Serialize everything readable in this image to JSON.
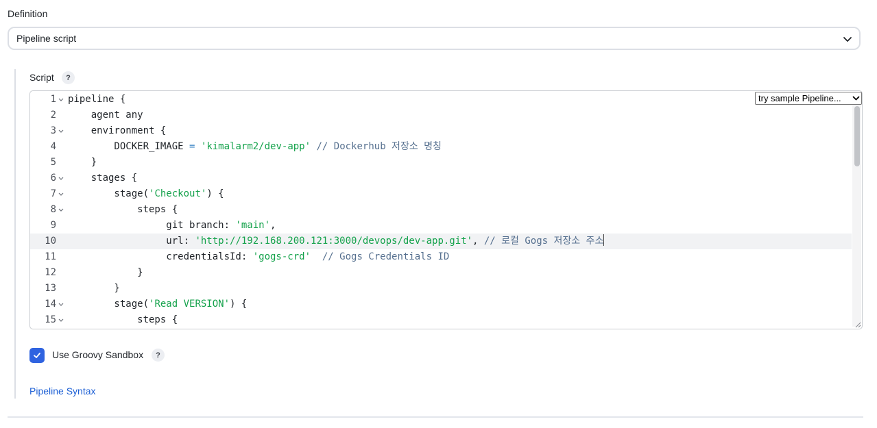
{
  "definition": {
    "label": "Definition",
    "selected": "Pipeline script"
  },
  "script": {
    "label": "Script",
    "help": "?",
    "sample_select": "try sample Pipeline...",
    "lines": [
      {
        "num": "1",
        "fold": true,
        "active": false,
        "tokens": [
          [
            "t",
            "pipeline {"
          ]
        ]
      },
      {
        "num": "2",
        "fold": false,
        "active": false,
        "tokens": [
          [
            "t",
            "    agent any"
          ]
        ]
      },
      {
        "num": "3",
        "fold": true,
        "active": false,
        "tokens": [
          [
            "t",
            "    environment {"
          ]
        ]
      },
      {
        "num": "4",
        "fold": false,
        "active": false,
        "tokens": [
          [
            "t",
            "        DOCKER_IMAGE "
          ],
          [
            "o",
            "="
          ],
          [
            "t",
            " "
          ],
          [
            "s",
            "'kimalarm2/dev-app'"
          ],
          [
            "t",
            " "
          ],
          [
            "c",
            "// Dockerhub 저장소 명칭"
          ]
        ]
      },
      {
        "num": "5",
        "fold": false,
        "active": false,
        "tokens": [
          [
            "t",
            "    }"
          ]
        ]
      },
      {
        "num": "6",
        "fold": true,
        "active": false,
        "tokens": [
          [
            "t",
            "    stages {"
          ]
        ]
      },
      {
        "num": "7",
        "fold": true,
        "active": false,
        "tokens": [
          [
            "t",
            "        stage("
          ],
          [
            "s",
            "'Checkout'"
          ],
          [
            "t",
            ") {"
          ]
        ]
      },
      {
        "num": "8",
        "fold": true,
        "active": false,
        "tokens": [
          [
            "t",
            "            steps {"
          ]
        ]
      },
      {
        "num": "9",
        "fold": false,
        "active": false,
        "tokens": [
          [
            "t",
            "                 git branch: "
          ],
          [
            "s",
            "'main'"
          ],
          [
            "t",
            ","
          ]
        ]
      },
      {
        "num": "10",
        "fold": false,
        "active": true,
        "tokens": [
          [
            "t",
            "                 url: "
          ],
          [
            "s",
            "'http://192.168.200.121:3000/devops/dev-app.git'"
          ],
          [
            "t",
            ", "
          ],
          [
            "c",
            "// 로컬 Gogs 저장소 주소"
          ],
          [
            "caret",
            ""
          ]
        ]
      },
      {
        "num": "11",
        "fold": false,
        "active": false,
        "tokens": [
          [
            "t",
            "                 credentialsId: "
          ],
          [
            "s",
            "'gogs-crd'"
          ],
          [
            "t",
            "  "
          ],
          [
            "c",
            "// Gogs Credentials ID"
          ]
        ]
      },
      {
        "num": "12",
        "fold": false,
        "active": false,
        "tokens": [
          [
            "t",
            "            }"
          ]
        ]
      },
      {
        "num": "13",
        "fold": false,
        "active": false,
        "tokens": [
          [
            "t",
            "        }"
          ]
        ]
      },
      {
        "num": "14",
        "fold": true,
        "active": false,
        "tokens": [
          [
            "t",
            "        stage("
          ],
          [
            "s",
            "'Read VERSION'"
          ],
          [
            "t",
            ") {"
          ]
        ]
      },
      {
        "num": "15",
        "fold": true,
        "active": false,
        "tokens": [
          [
            "t",
            "            steps {"
          ]
        ]
      }
    ]
  },
  "sandbox": {
    "label": "Use Groovy Sandbox",
    "checked": true,
    "help": "?"
  },
  "links": {
    "pipeline_syntax": "Pipeline Syntax"
  },
  "colors": {
    "accent": "#2f63e0",
    "link": "#1e60d5",
    "string": "#14a24b",
    "comment": "#56708f"
  }
}
